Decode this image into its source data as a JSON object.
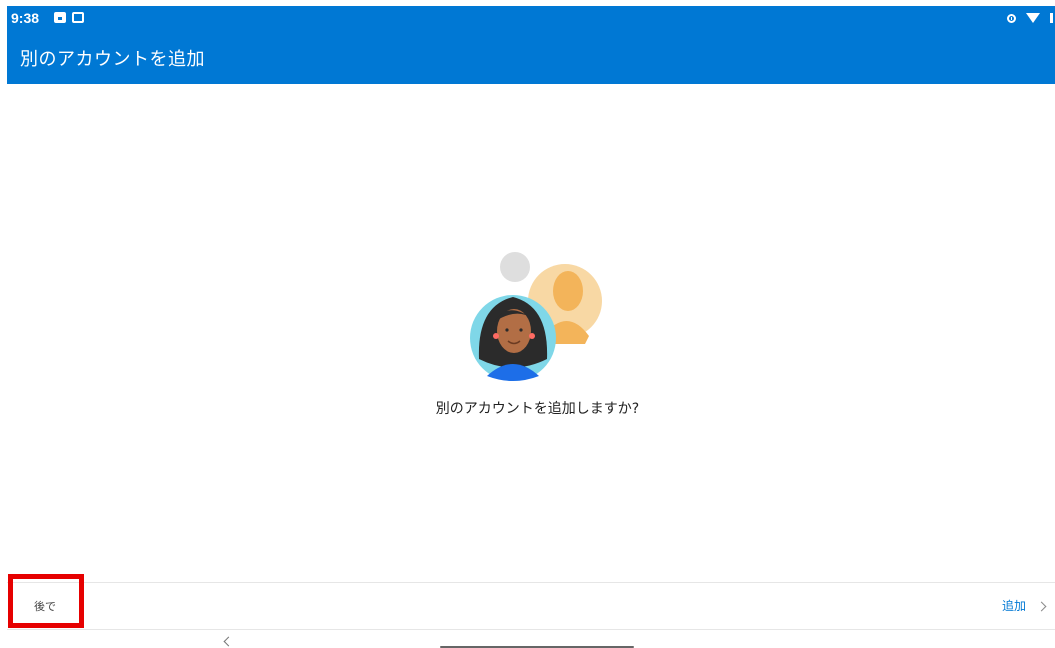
{
  "status_bar": {
    "time": "9:38",
    "left_icons": [
      "gallery-notification-icon",
      "photo-notification-icon"
    ],
    "right_icons": [
      "data-saver-icon",
      "wifi-icon",
      "battery-icon"
    ]
  },
  "app_bar": {
    "title": "別のアカウントを追加",
    "color": "#0078d4"
  },
  "main": {
    "illustration": "add-account-avatars-illustration",
    "prompt": "別のアカウントを追加しますか?"
  },
  "footer": {
    "later_label": "後で",
    "add_label": "追加",
    "highlight_color": "#e60000"
  },
  "navigation": {
    "icons": [
      "back-icon",
      "home-handle"
    ]
  }
}
